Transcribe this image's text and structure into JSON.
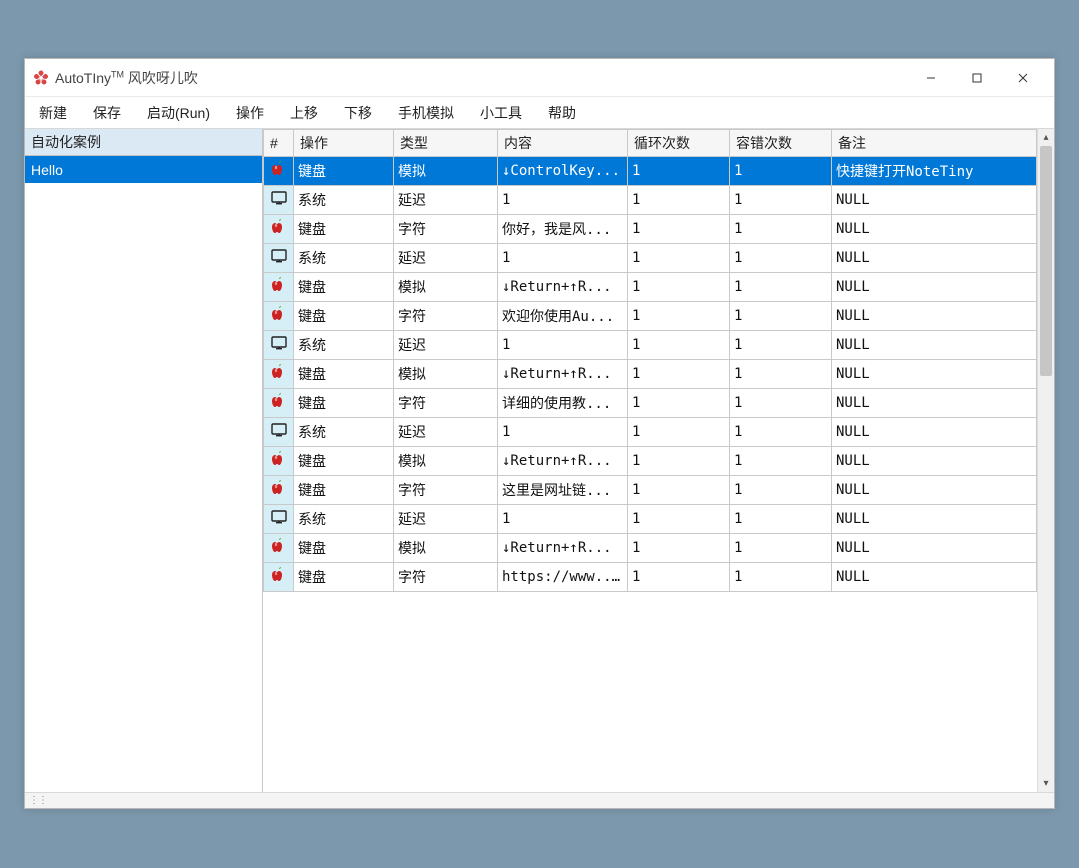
{
  "window": {
    "title_prefix": "AutoTIny",
    "title_suffix": " 风吹呀儿吹"
  },
  "menu": [
    "新建",
    "保存",
    "启动(Run)",
    "操作",
    "上移",
    "下移",
    "手机模拟",
    "小工具",
    "帮助"
  ],
  "sidebar": {
    "header": "自动化案例",
    "items": [
      "Hello"
    ]
  },
  "table": {
    "headers": [
      "#",
      "操作",
      "类型",
      "内容",
      "循环次数",
      "容错次数",
      "备注"
    ],
    "rows": [
      {
        "icon": "apple",
        "op": "键盘",
        "type": "模拟",
        "content": "↓ControlKey...",
        "loop": "1",
        "tol": "1",
        "note": "快捷键打开NoteTiny",
        "selected": true
      },
      {
        "icon": "system",
        "op": "系统",
        "type": "延迟",
        "content": "1",
        "loop": "1",
        "tol": "1",
        "note": "NULL"
      },
      {
        "icon": "apple",
        "op": "键盘",
        "type": "字符",
        "content": "你好，我是风...",
        "loop": "1",
        "tol": "1",
        "note": "NULL"
      },
      {
        "icon": "system",
        "op": "系统",
        "type": "延迟",
        "content": "1",
        "loop": "1",
        "tol": "1",
        "note": "NULL"
      },
      {
        "icon": "apple",
        "op": "键盘",
        "type": "模拟",
        "content": "↓Return+↑R...",
        "loop": "1",
        "tol": "1",
        "note": "NULL"
      },
      {
        "icon": "apple",
        "op": "键盘",
        "type": "字符",
        "content": "欢迎你使用Au...",
        "loop": "1",
        "tol": "1",
        "note": "NULL"
      },
      {
        "icon": "system",
        "op": "系统",
        "type": "延迟",
        "content": "1",
        "loop": "1",
        "tol": "1",
        "note": "NULL"
      },
      {
        "icon": "apple",
        "op": "键盘",
        "type": "模拟",
        "content": "↓Return+↑R...",
        "loop": "1",
        "tol": "1",
        "note": "NULL"
      },
      {
        "icon": "apple",
        "op": "键盘",
        "type": "字符",
        "content": "详细的使用教...",
        "loop": "1",
        "tol": "1",
        "note": "NULL"
      },
      {
        "icon": "system",
        "op": "系统",
        "type": "延迟",
        "content": "1",
        "loop": "1",
        "tol": "1",
        "note": "NULL"
      },
      {
        "icon": "apple",
        "op": "键盘",
        "type": "模拟",
        "content": "↓Return+↑R...",
        "loop": "1",
        "tol": "1",
        "note": "NULL"
      },
      {
        "icon": "apple",
        "op": "键盘",
        "type": "字符",
        "content": "这里是网址链...",
        "loop": "1",
        "tol": "1",
        "note": "NULL"
      },
      {
        "icon": "system",
        "op": "系统",
        "type": "延迟",
        "content": "1",
        "loop": "1",
        "tol": "1",
        "note": "NULL"
      },
      {
        "icon": "apple",
        "op": "键盘",
        "type": "模拟",
        "content": "↓Return+↑R...",
        "loop": "1",
        "tol": "1",
        "note": "NULL"
      },
      {
        "icon": "apple",
        "op": "键盘",
        "type": "字符",
        "content": "https://www....",
        "loop": "1",
        "tol": "1",
        "note": "NULL"
      }
    ]
  }
}
